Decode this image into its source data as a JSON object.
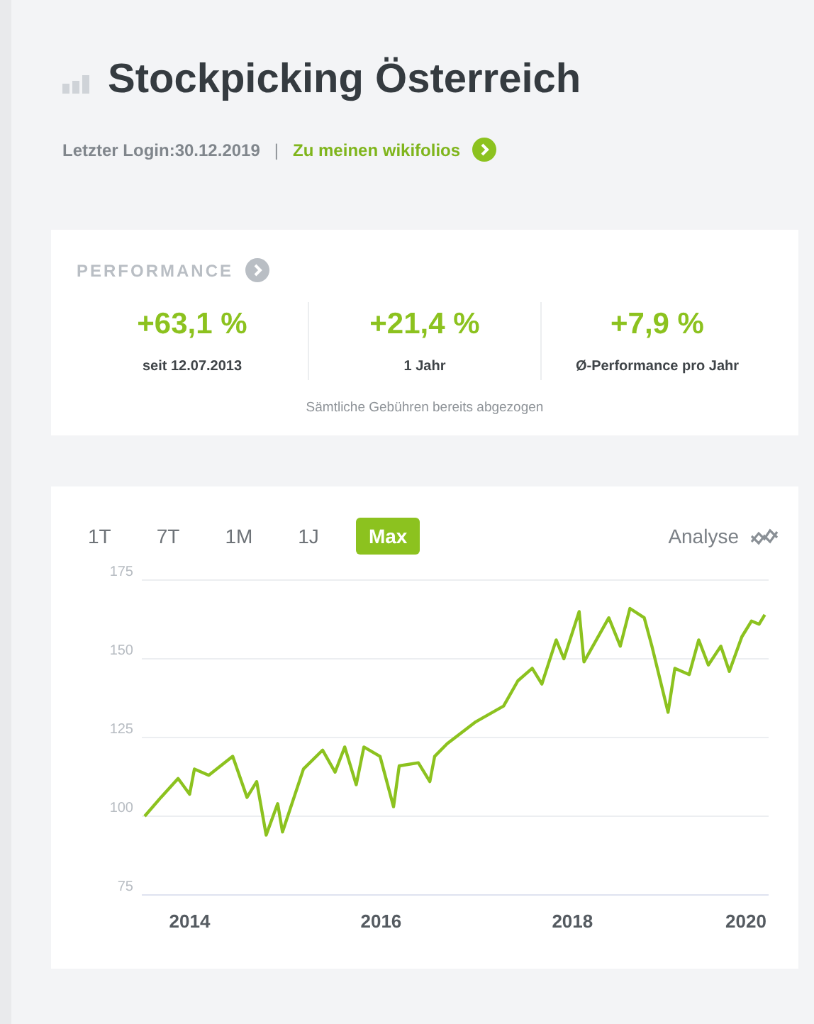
{
  "header": {
    "title": "Stockpicking Österreich",
    "last_login": "Letzter Login:30.12.2019",
    "separator": "|",
    "link": "Zu meinen wikifolios"
  },
  "performance": {
    "heading": "PERFORMANCE",
    "stats": [
      {
        "value": "+63,1 %",
        "label": "seit 12.07.2013"
      },
      {
        "value": "+21,4 %",
        "label": "1 Jahr"
      },
      {
        "value": "+7,9 %",
        "label": "Ø-Performance pro Jahr"
      }
    ],
    "note": "Sämtliche Gebühren bereits abgezogen"
  },
  "chart": {
    "ranges": [
      {
        "label": "1T",
        "selected": false
      },
      {
        "label": "7T",
        "selected": false
      },
      {
        "label": "1M",
        "selected": false
      },
      {
        "label": "1J",
        "selected": false
      },
      {
        "label": "Max",
        "selected": true
      }
    ],
    "analyse": "Analyse",
    "chart_data": {
      "type": "line",
      "grid": true,
      "xlim": [
        2013.5,
        2020.05
      ],
      "ylim": [
        75,
        175
      ],
      "xticks": [
        2014,
        2016,
        2018,
        2020
      ],
      "yticks": [
        75,
        100,
        125,
        150,
        175
      ],
      "series": [
        {
          "color": "#8cc21f",
          "x": [
            2013.53,
            2013.7,
            2013.88,
            2014.0,
            2014.05,
            2014.2,
            2014.45,
            2014.6,
            2014.7,
            2014.8,
            2014.92,
            2014.97,
            2015.19,
            2015.39,
            2015.52,
            2015.62,
            2015.74,
            2015.82,
            2015.99,
            2016.13,
            2016.19,
            2016.39,
            2016.51,
            2016.56,
            2016.69,
            2016.99,
            2017.28,
            2017.43,
            2017.58,
            2017.68,
            2017.83,
            2017.91,
            2018.07,
            2018.12,
            2018.38,
            2018.5,
            2018.6,
            2018.75,
            2018.83,
            2019.0,
            2019.07,
            2019.22,
            2019.32,
            2019.42,
            2019.55,
            2019.64,
            2019.77,
            2019.87,
            2019.95,
            2020.01
          ],
          "values": [
            100,
            106,
            112,
            107,
            115,
            113,
            119,
            106,
            111,
            94,
            104,
            95,
            115,
            121,
            114,
            122,
            110,
            122,
            119,
            103,
            116,
            117,
            111,
            119,
            123,
            130,
            135,
            143,
            147,
            142,
            156,
            150,
            165,
            149,
            163,
            154,
            166,
            163,
            154,
            133,
            147,
            145,
            156,
            148,
            154,
            146,
            157,
            162,
            161,
            164
          ]
        }
      ]
    }
  }
}
